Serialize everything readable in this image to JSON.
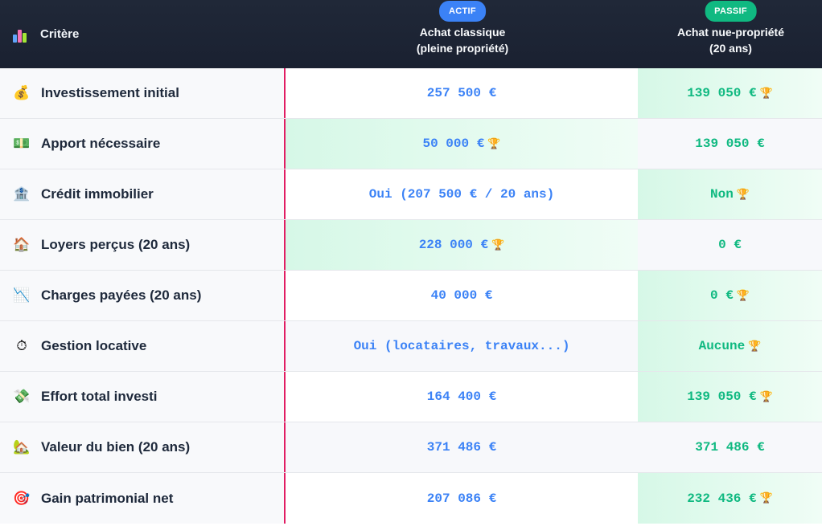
{
  "header": {
    "criterion_label": "Critère",
    "columns": [
      {
        "badge": "ACTIF",
        "title_line1": "Achat classique",
        "title_line2": "(pleine propriété)",
        "badge_color": "#3b82f6"
      },
      {
        "badge": "PASSIF",
        "title_line1": "Achat nue-propriété",
        "title_line2": "(20 ans)",
        "badge_color": "#10b981"
      }
    ]
  },
  "trophy_icon": "🏆",
  "rows": [
    {
      "icon": "💰",
      "icon_name": "money-bag-icon",
      "label": "Investissement initial",
      "classic": "257 500 €",
      "nue": "139 050 €",
      "winner": "nue"
    },
    {
      "icon": "💵",
      "icon_name": "banknote-icon",
      "label": "Apport nécessaire",
      "classic": "50 000 €",
      "nue": "139 050 €",
      "winner": "classic"
    },
    {
      "icon": "🏦",
      "icon_name": "bank-icon",
      "label": "Crédit immobilier",
      "classic": "Oui (207 500 € / 20 ans)",
      "nue": "Non",
      "winner": "nue"
    },
    {
      "icon": "🏠",
      "icon_name": "house-icon",
      "label": "Loyers perçus (20 ans)",
      "classic": "228 000 €",
      "nue": "0 €",
      "winner": "classic"
    },
    {
      "icon": "📉",
      "icon_name": "chart-decreasing-icon",
      "label": "Charges payées (20 ans)",
      "classic": "40 000 €",
      "nue": "0 €",
      "winner": "nue"
    },
    {
      "icon": "⏱",
      "icon_name": "stopwatch-icon",
      "label": "Gestion locative",
      "classic": "Oui (locataires, travaux...)",
      "nue": "Aucune",
      "winner": "nue"
    },
    {
      "icon": "💸",
      "icon_name": "money-wings-icon",
      "label": "Effort total investi",
      "classic": "164 400 €",
      "nue": "139 050 €",
      "winner": "nue"
    },
    {
      "icon": "🏡",
      "icon_name": "house-garden-icon",
      "label": "Valeur du bien (20 ans)",
      "classic": "371 486 €",
      "nue": "371 486 €",
      "winner": "none"
    },
    {
      "icon": "🎯",
      "icon_name": "target-icon",
      "label": "Gain patrimonial net",
      "classic": "207 086 €",
      "nue": "232 436 €",
      "winner": "nue"
    }
  ]
}
